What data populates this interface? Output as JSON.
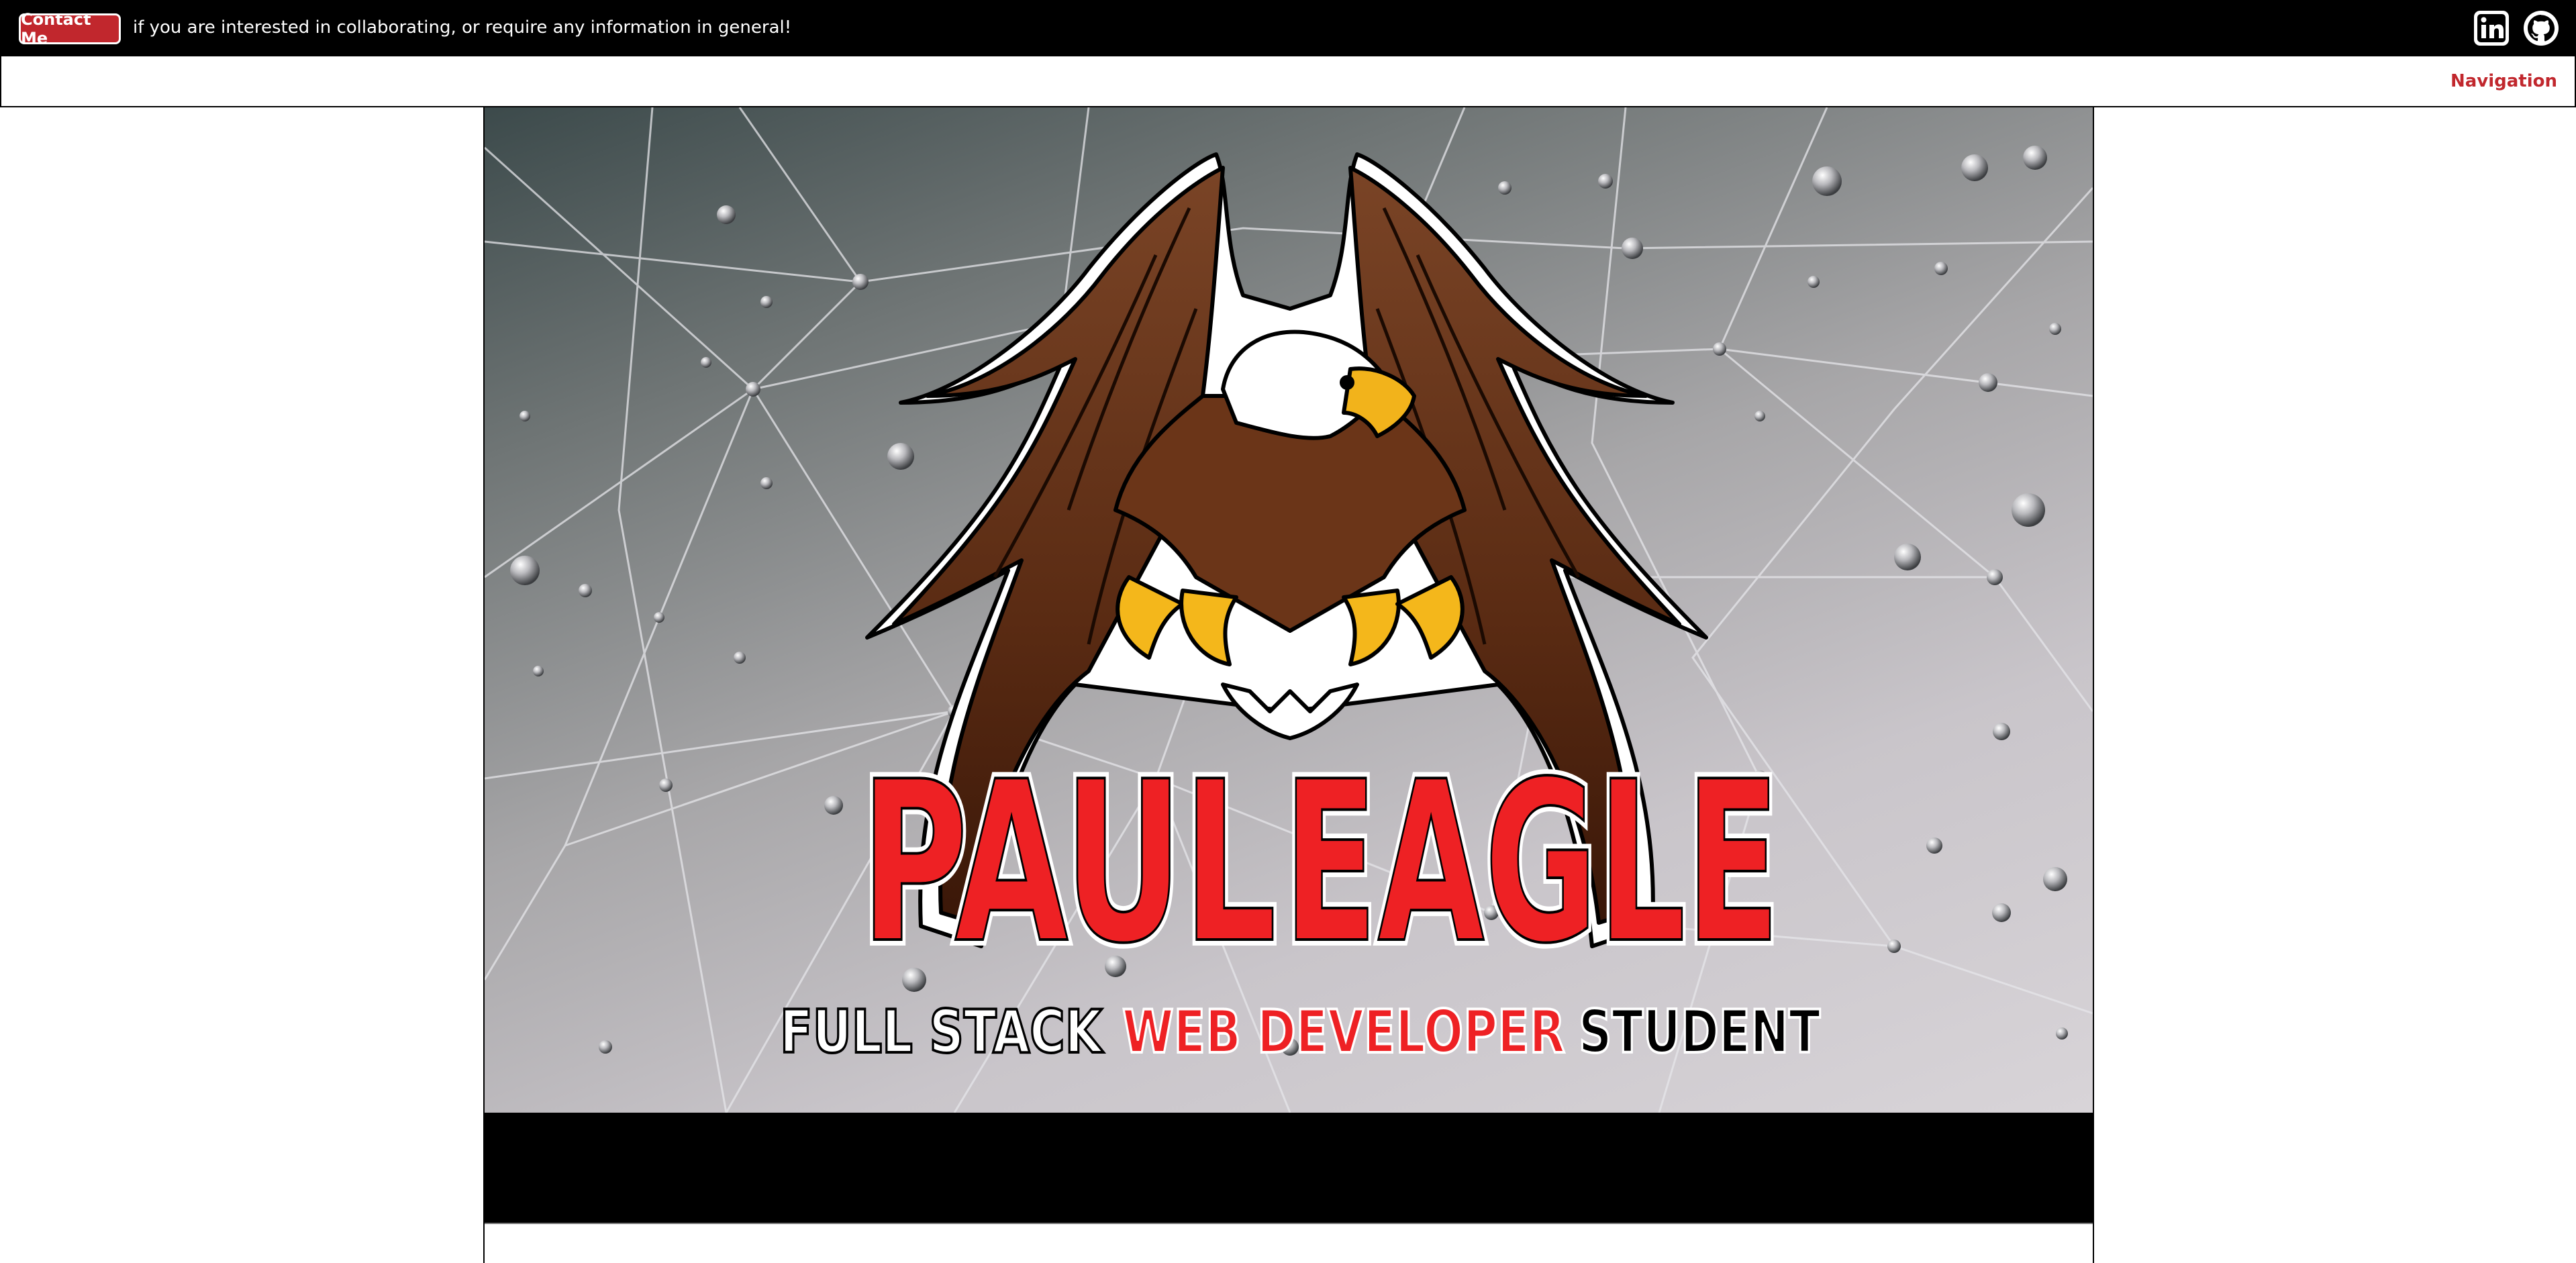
{
  "topbar": {
    "contact_label": "Contact Me",
    "message": "if you are interested in collaborating, or require any information in general!",
    "social": [
      {
        "name": "linkedin-icon"
      },
      {
        "name": "github-icon"
      }
    ]
  },
  "nav": {
    "label": "Navigation"
  },
  "hero": {
    "name_first": "PAUL",
    "name_last": "EAGLE",
    "tagline_part1": "FULL STACK",
    "tagline_part2": "WEB DEVELOPER",
    "tagline_part3": "STUDENT",
    "image": "eagle-logo-on-spiderweb"
  },
  "colors": {
    "accent": "#c1272d",
    "title_red": "#ee2124",
    "topbar_bg": "#000000",
    "eagle_brown": "#5a2e16"
  }
}
